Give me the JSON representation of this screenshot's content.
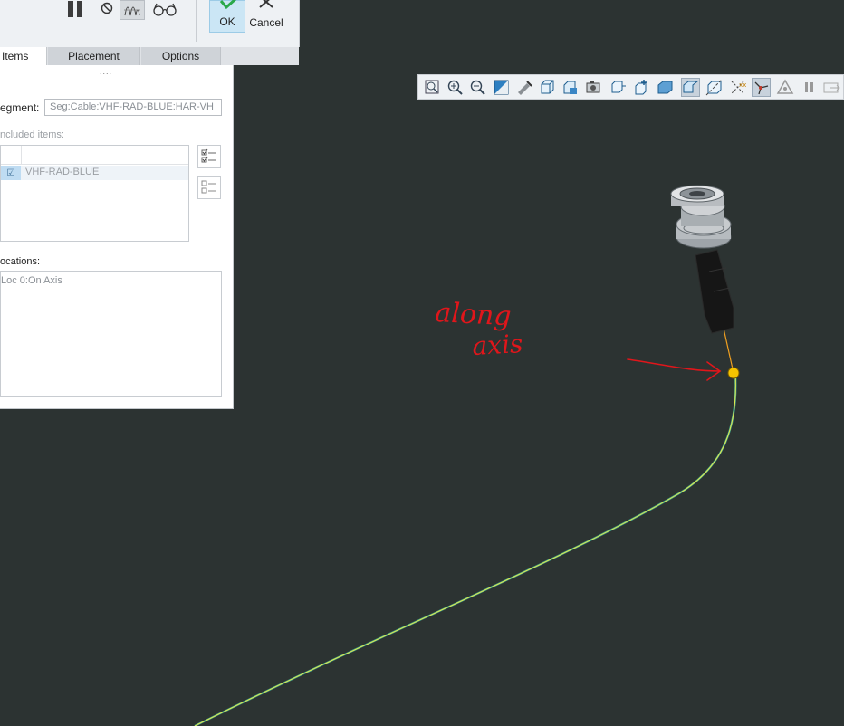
{
  "ribbon": {
    "ok_label": "OK",
    "cancel_label": "Cancel",
    "icons": [
      "pause-icon",
      "no-entry-icon",
      "wave-icon",
      "glasses-icon",
      "checkmark-icon",
      "close-icon"
    ]
  },
  "tabs": [
    {
      "label": "Items",
      "active": true
    },
    {
      "label": "Placement",
      "active": false
    },
    {
      "label": "Options",
      "active": false
    }
  ],
  "panel": {
    "grip": "....",
    "segment_label": "egment:",
    "segment_value": "Seg:Cable:VHF-RAD-BLUE:HAR-VH",
    "included_label": "ncluded items:",
    "included_items": [
      {
        "label": "VHF-RAD-BLUE",
        "checked": true
      }
    ],
    "locations_label": "ocations:",
    "locations": [
      "Loc 0:On Axis"
    ]
  },
  "view_toolbar": {
    "icons": [
      "refit-icon",
      "zoom-in-icon",
      "zoom-out-icon",
      "repaint-icon",
      "pan-icon",
      "view-box-icon",
      "saved-views-icon",
      "camera-icon",
      "section-icon",
      "annotation-icon",
      "display-style-icon",
      "datum-plane-icon",
      "datum-axis-icon",
      "datum-point-icon",
      "coordinate-system-icon",
      "spin-center-icon",
      "pause-icon",
      "exit-icon"
    ]
  },
  "annotation": {
    "line1": "along",
    "line2": "axis",
    "color": "#e0161b"
  },
  "colors": {
    "viewport_bg": "#2c3332",
    "cable": "#e8e84a",
    "point": "#f5c400",
    "selected_tab": "#ffffff"
  }
}
